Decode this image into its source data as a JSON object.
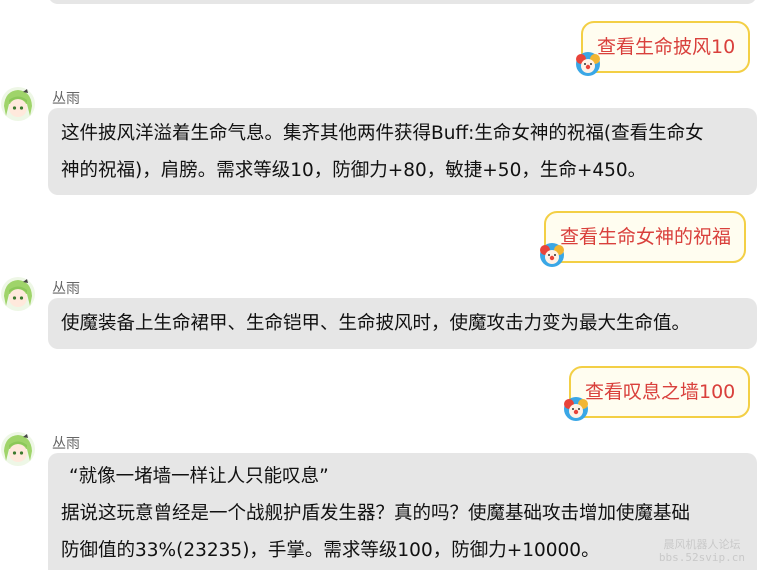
{
  "colors": {
    "user_bubble_bg": "#fffdf0",
    "user_bubble_border": "#f3cf45",
    "user_text": "#d9403c",
    "bot_bubble_bg": "#e6e6e6",
    "bot_text": "#111111",
    "name_text": "#666666"
  },
  "icons": {
    "bot_avatar": "anime-girl-avatar-icon",
    "user_avatar": "clown-avatar-icon"
  },
  "messages": [
    {
      "role": "user",
      "text": "查看生命披风10"
    },
    {
      "role": "bot",
      "name": "丛雨",
      "lines": [
        "这件披风洋溢着生命气息。集齐其他两件获得Buff:生命女神的祝福(查看生命女",
        "神的祝福)，肩膀。需求等级10，防御力+80，敏捷+50，生命+450。"
      ]
    },
    {
      "role": "user",
      "text": "查看生命女神的祝福"
    },
    {
      "role": "bot",
      "name": "丛雨",
      "lines": [
        "使魔装备上生命裙甲、生命铠甲、生命披风时，使魔攻击力变为最大生命值。"
      ]
    },
    {
      "role": "user",
      "text": "查看叹息之墙100"
    },
    {
      "role": "bot",
      "name": "丛雨",
      "lines": [
        "“就像一堵墙一样让人只能叹息”",
        "据说这玩意曾经是一个战舰护盾发生器？真的吗？使魔基础攻击增加使魔基础",
        "防御值的33%(23235)，手掌。需求等级100，防御力+10000。"
      ]
    }
  ],
  "watermark": {
    "line1": "晨风机器人论坛",
    "line2": "bbs.52svip.cn"
  }
}
